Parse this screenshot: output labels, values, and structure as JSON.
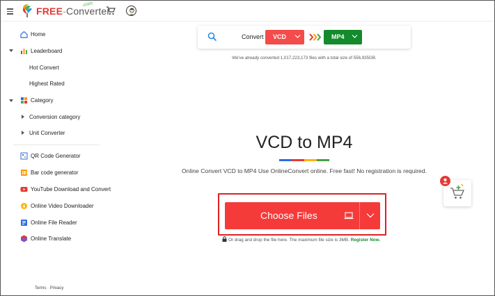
{
  "header": {
    "brand_free": "FREE",
    "brand_dash": "-",
    "brand_converter": "Converter",
    "brand_com": ".com"
  },
  "sidebar": {
    "items": [
      {
        "label": "Home",
        "icon": "home-icon"
      },
      {
        "label": "Leaderboard",
        "icon": "bar-chart-icon"
      },
      {
        "label": "Hot Convert"
      },
      {
        "label": "Highest Rated"
      },
      {
        "label": "Category",
        "icon": "category-grid-icon"
      },
      {
        "label": "Conversion category"
      },
      {
        "label": "Unit Converter"
      },
      {
        "label": "QR Code Generator",
        "icon": "qr-code-icon"
      },
      {
        "label": "Bar code generator",
        "icon": "barcode-icon"
      },
      {
        "label": "YouTube Download and Convert",
        "icon": "youtube-icon"
      },
      {
        "label": "Online Video Downloader",
        "icon": "video-download-icon"
      },
      {
        "label": "Online File Reader",
        "icon": "file-reader-icon"
      },
      {
        "label": "Online Translate",
        "icon": "translate-icon"
      }
    ],
    "terms": "Terms",
    "separator": "·",
    "privacy": "Privacy"
  },
  "convert_bar": {
    "label": "Convert",
    "from_format": "VCD",
    "to_format": "MP4"
  },
  "stats": {
    "prefix": "We've already converted ",
    "files": "1,017,223,173",
    "middle": " files with a total size of ",
    "size": "556,935GB",
    "suffix": "."
  },
  "main": {
    "title": "VCD to MP4",
    "subtitle": "Online Convert VCD to MP4 Use OnlineConvert online. Free fast! No registration is required.",
    "choose_files": "Choose Files",
    "drop_note": "Or drag and drop the file here. The maximum file size is 3MB.",
    "register": "Register Now."
  },
  "colors": {
    "brand_red": "#e53935",
    "from_select": "#f44b4b",
    "to_select": "#138a2b",
    "choose_button": "#f53a3a",
    "register_link": "#1a8a33"
  }
}
